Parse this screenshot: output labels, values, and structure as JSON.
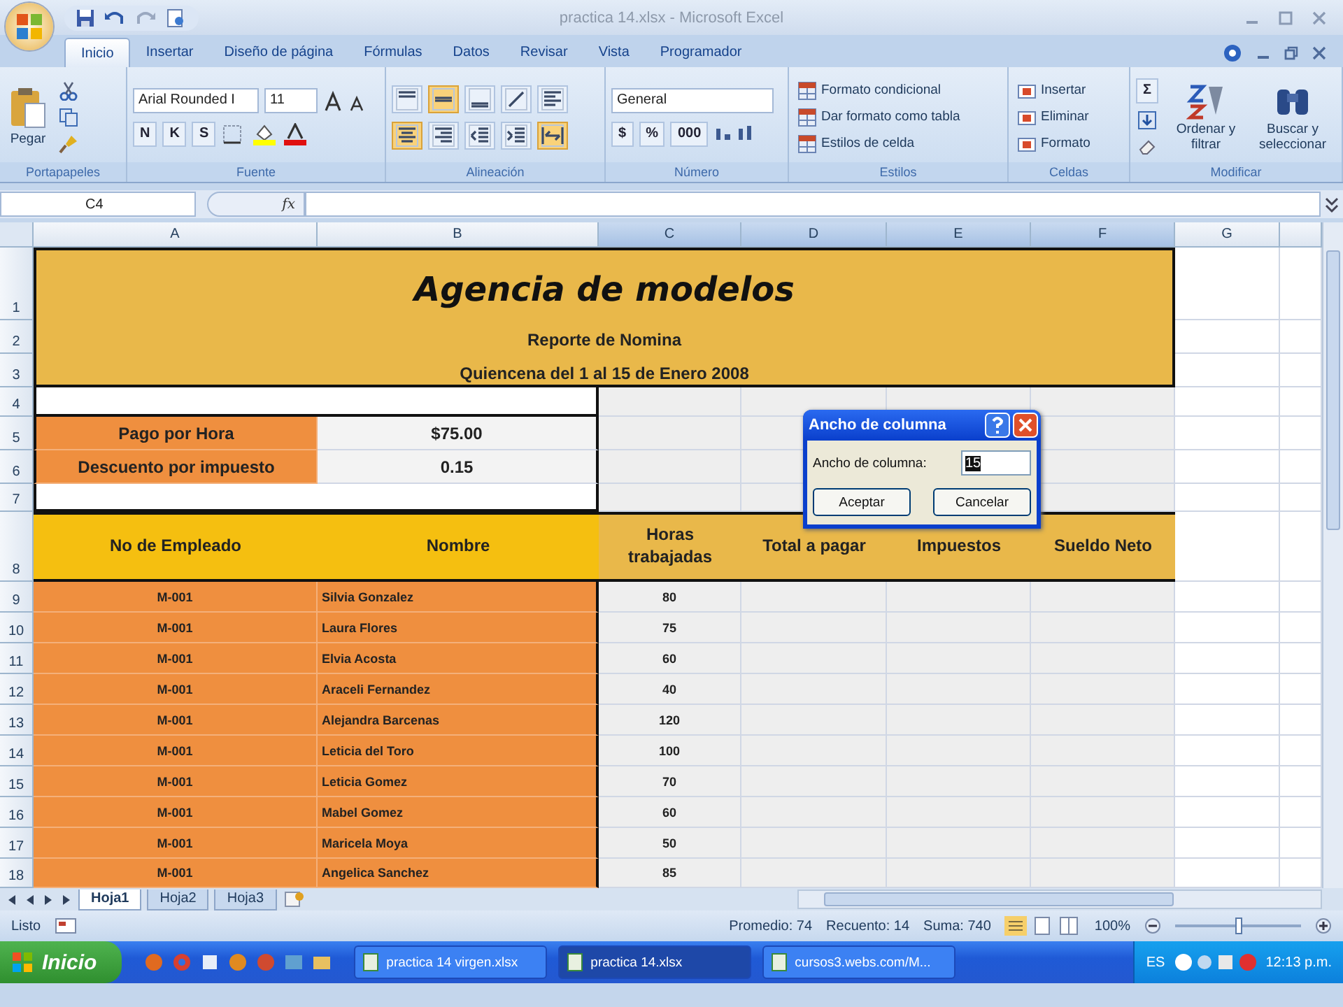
{
  "window": {
    "title": "practica 14.xlsx - Microsoft Excel"
  },
  "ribbon_tabs": [
    {
      "label": "Inicio",
      "selected": true
    },
    {
      "label": "Insertar",
      "selected": false
    },
    {
      "label": "Diseño de página",
      "selected": false
    },
    {
      "label": "Fórmulas",
      "selected": false
    },
    {
      "label": "Datos",
      "selected": false
    },
    {
      "label": "Revisar",
      "selected": false
    },
    {
      "label": "Vista",
      "selected": false
    },
    {
      "label": "Programador",
      "selected": false
    }
  ],
  "clipboard": {
    "paste": "Pegar",
    "label": "Portapapeles"
  },
  "font": {
    "name": "Arial Rounded I",
    "size": "11",
    "styles": [
      "N",
      "K",
      "S"
    ],
    "label": "Fuente"
  },
  "alignment": {
    "label": "Alineación",
    "buttons": [
      {
        "kind": "top",
        "selected": false
      },
      {
        "kind": "middle",
        "selected": true
      },
      {
        "kind": "bottom",
        "selected": false
      },
      {
        "kind": "orientation",
        "selected": false
      },
      {
        "kind": "left",
        "selected": false
      },
      {
        "kind": "center",
        "selected": true
      },
      {
        "kind": "right",
        "selected": false
      },
      {
        "kind": "outdent",
        "selected": false
      },
      {
        "kind": "indent",
        "selected": false
      },
      {
        "kind": "merge",
        "selected": true
      }
    ]
  },
  "number": {
    "format": "General",
    "buttons": [
      "$",
      "%",
      "000"
    ],
    "label": "Número"
  },
  "styles": {
    "items": [
      "Formato condicional",
      "Dar formato como tabla",
      "Estilos de celda"
    ],
    "label": "Estilos"
  },
  "cells": {
    "items": [
      "Insertar",
      "Eliminar",
      "Formato"
    ],
    "label": "Celdas"
  },
  "editing": {
    "sum": "Σ",
    "sort": "Ordenar y filtrar",
    "find": "Buscar y seleccionar",
    "label": "Modificar"
  },
  "formula_bar": {
    "name_box": "C4",
    "function_label": "fx"
  },
  "columns": [
    {
      "label": "A",
      "selected": false
    },
    {
      "label": "B",
      "selected": false
    },
    {
      "label": "C",
      "selected": true
    },
    {
      "label": "D",
      "selected": true
    },
    {
      "label": "E",
      "selected": true
    },
    {
      "label": "F",
      "selected": true
    },
    {
      "label": "G",
      "selected": false
    }
  ],
  "row_numbers": [
    "1",
    "2",
    "3",
    "4",
    "5",
    "6",
    "7",
    "8",
    "9",
    "10",
    "11",
    "12",
    "13",
    "14",
    "15",
    "16",
    "17",
    "18"
  ],
  "sheet": {
    "title": "Agencia de modelos",
    "subtitle": "Reporte de Nomina",
    "period": "Quiencena del 1 al 15 de Enero 2008",
    "parameters": [
      {
        "label": "Pago por Hora",
        "value": "$75.00"
      },
      {
        "label": "Descuento por impuesto",
        "value": "0.15"
      }
    ],
    "headers": [
      "No de Empleado",
      "Nombre",
      "Horas trabajadas",
      "Total a pagar",
      "Impuestos",
      "Sueldo Neto"
    ],
    "employees": [
      {
        "id": "M-001",
        "name": "Silvia Gonzalez",
        "hours": "80"
      },
      {
        "id": "M-001",
        "name": "Laura Flores",
        "hours": "75"
      },
      {
        "id": "M-001",
        "name": "Elvia Acosta",
        "hours": "60"
      },
      {
        "id": "M-001",
        "name": "Araceli Fernandez",
        "hours": "40"
      },
      {
        "id": "M-001",
        "name": "Alejandra Barcenas",
        "hours": "120"
      },
      {
        "id": "M-001",
        "name": "Leticia del Toro",
        "hours": "100"
      },
      {
        "id": "M-001",
        "name": "Leticia Gomez",
        "hours": "70"
      },
      {
        "id": "M-001",
        "name": "Mabel Gomez",
        "hours": "60"
      },
      {
        "id": "M-001",
        "name": "Maricela Moya",
        "hours": "50"
      },
      {
        "id": "M-001",
        "name": "Angelica Sanchez",
        "hours": "85"
      }
    ]
  },
  "dialog": {
    "title": "Ancho de columna",
    "field_label": "Ancho de columna:",
    "value": "15",
    "buttons": [
      "Aceptar",
      "Cancelar"
    ]
  },
  "sheet_tabs": [
    {
      "label": "Hoja1",
      "selected": true
    },
    {
      "label": "Hoja2",
      "selected": false
    },
    {
      "label": "Hoja3",
      "selected": false
    }
  ],
  "status_bar": {
    "mode": "Listo",
    "average": "Promedio: 74",
    "count": "Recuento: 14",
    "sum": "Suma: 740",
    "zoom": "100%",
    "zoom_level": {
      "level": 0.5
    }
  },
  "taskbar": {
    "start": "Inicio",
    "windows": [
      {
        "label": "practica 14 virgen.xlsx",
        "selected": false
      },
      {
        "label": "practica 14.xlsx",
        "selected": true
      },
      {
        "label": "cursos3.webs.com/M...",
        "selected": false
      }
    ],
    "language": "ES",
    "clock": "12:13 p.m."
  }
}
